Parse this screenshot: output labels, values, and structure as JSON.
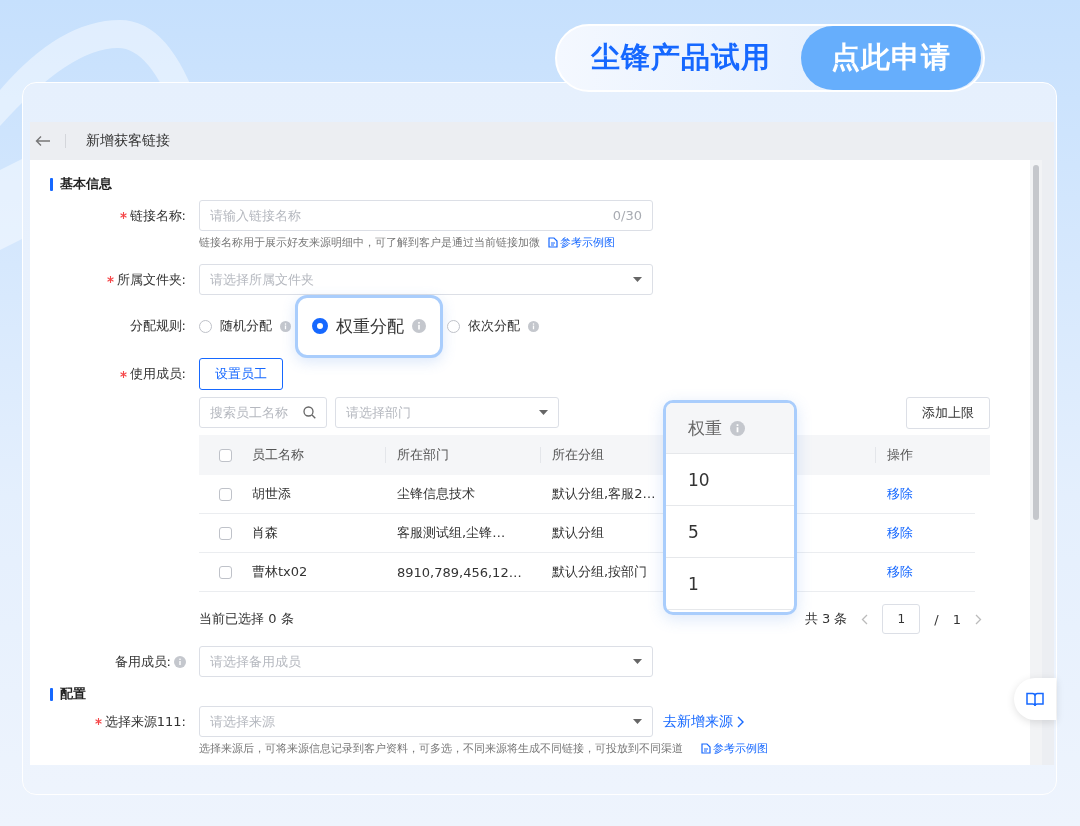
{
  "promo": {
    "title": "尘锋产品试用",
    "button": "点此申请"
  },
  "page_header": {
    "title": "新增获客链接"
  },
  "basic_section": {
    "title": "基本信息"
  },
  "link_name": {
    "label": "链接名称:",
    "required": true,
    "placeholder": "请输入链接名称",
    "counter": "0/30",
    "hint": "链接名称用于展示好友来源明细中，可了解到客户是通过当前链接加微",
    "hint_link": "参考示例图"
  },
  "folder": {
    "label": "所属文件夹:",
    "required": true,
    "placeholder": "请选择所属文件夹"
  },
  "rule": {
    "label": "分配规则:",
    "options": [
      {
        "label": "随机分配",
        "selected": false
      },
      {
        "label": "权重分配",
        "selected": true
      },
      {
        "label": "依次分配",
        "selected": false
      }
    ]
  },
  "members": {
    "label": "使用成员:",
    "required": true,
    "button": "设置员工",
    "search_placeholder": "搜索员工名称",
    "dept_placeholder": "请选择部门",
    "limit_button": "添加上限",
    "table": {
      "all_checked": false,
      "columns": [
        "员工名称",
        "所在部门",
        "所在分组",
        "权重",
        "操作"
      ],
      "rows": [
        {
          "checked": false,
          "name": "胡世添",
          "dept": "尘锋信息技术",
          "group": "默认分组,客服2…",
          "weight": "10",
          "action": "移除"
        },
        {
          "checked": false,
          "name": "肖森",
          "dept": "客服测试组,尘锋…",
          "group": "默认分组",
          "weight": "5",
          "action": "移除"
        },
        {
          "checked": false,
          "name": "曹林tx02",
          "dept": "8910,789,456,12…",
          "group": "默认分组,按部门",
          "weight": "1",
          "action": "移除"
        }
      ]
    },
    "selected_count": "当前已选择 0 条",
    "total": "共 3 条",
    "page": "1",
    "separator": "/",
    "page_count": "1"
  },
  "backup": {
    "label": "备用成员:",
    "required": false,
    "info": true,
    "placeholder": "请选择备用成员"
  },
  "config_section": {
    "title": "配置"
  },
  "source": {
    "label": "选择来源111:",
    "required": true,
    "placeholder": "请选择来源",
    "link": "去新增来源",
    "hint": "选择来源后，可将来源信息记录到客户资料，可多选，不同来源将生成不同链接，可投放到不同渠道",
    "hint_link": "参考示例图"
  }
}
